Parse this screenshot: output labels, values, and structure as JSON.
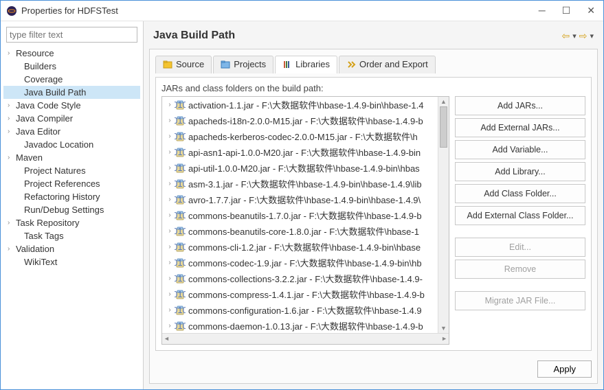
{
  "window": {
    "title": "Properties for HDFSTest"
  },
  "filter": {
    "placeholder": "type filter text"
  },
  "tree": [
    {
      "label": "Resource",
      "expandable": true
    },
    {
      "label": "Builders",
      "expandable": false
    },
    {
      "label": "Coverage",
      "expandable": false
    },
    {
      "label": "Java Build Path",
      "expandable": false,
      "selected": true
    },
    {
      "label": "Java Code Style",
      "expandable": true
    },
    {
      "label": "Java Compiler",
      "expandable": true
    },
    {
      "label": "Java Editor",
      "expandable": true
    },
    {
      "label": "Javadoc Location",
      "expandable": false
    },
    {
      "label": "Maven",
      "expandable": true
    },
    {
      "label": "Project Natures",
      "expandable": false
    },
    {
      "label": "Project References",
      "expandable": false
    },
    {
      "label": "Refactoring History",
      "expandable": false
    },
    {
      "label": "Run/Debug Settings",
      "expandable": false
    },
    {
      "label": "Task Repository",
      "expandable": true
    },
    {
      "label": "Task Tags",
      "expandable": false
    },
    {
      "label": "Validation",
      "expandable": true
    },
    {
      "label": "WikiText",
      "expandable": false
    }
  ],
  "page_title": "Java Build Path",
  "tabs": [
    {
      "label": "Source",
      "icon": "source"
    },
    {
      "label": "Projects",
      "icon": "projects"
    },
    {
      "label": "Libraries",
      "icon": "libraries",
      "active": true
    },
    {
      "label": "Order and Export",
      "icon": "order"
    }
  ],
  "tab_desc": "JARs and class folders on the build path:",
  "jars": [
    "activation-1.1.jar - F:\\大数据软件\\hbase-1.4.9-bin\\hbase-1.4",
    "apacheds-i18n-2.0.0-M15.jar - F:\\大数据软件\\hbase-1.4.9-b",
    "apacheds-kerberos-codec-2.0.0-M15.jar - F:\\大数据软件\\h",
    "api-asn1-api-1.0.0-M20.jar - F:\\大数据软件\\hbase-1.4.9-bin",
    "api-util-1.0.0-M20.jar - F:\\大数据软件\\hbase-1.4.9-bin\\hbas",
    "asm-3.1.jar - F:\\大数据软件\\hbase-1.4.9-bin\\hbase-1.4.9\\lib",
    "avro-1.7.7.jar - F:\\大数据软件\\hbase-1.4.9-bin\\hbase-1.4.9\\",
    "commons-beanutils-1.7.0.jar - F:\\大数据软件\\hbase-1.4.9-b",
    "commons-beanutils-core-1.8.0.jar - F:\\大数据软件\\hbase-1",
    "commons-cli-1.2.jar - F:\\大数据软件\\hbase-1.4.9-bin\\hbase",
    "commons-codec-1.9.jar - F:\\大数据软件\\hbase-1.4.9-bin\\hb",
    "commons-collections-3.2.2.jar - F:\\大数据软件\\hbase-1.4.9-",
    "commons-compress-1.4.1.jar - F:\\大数据软件\\hbase-1.4.9-b",
    "commons-configuration-1.6.jar - F:\\大数据软件\\hbase-1.4.9",
    "commons-daemon-1.0.13.jar - F:\\大数据软件\\hbase-1.4.9-b"
  ],
  "buttons": {
    "add_jars": "Add JARs...",
    "add_ext_jars": "Add External JARs...",
    "add_var": "Add Variable...",
    "add_lib": "Add Library...",
    "add_cf": "Add Class Folder...",
    "add_ext_cf": "Add External Class Folder...",
    "edit": "Edit...",
    "remove": "Remove",
    "migrate": "Migrate JAR File..."
  },
  "footer": {
    "apply": "Apply"
  }
}
